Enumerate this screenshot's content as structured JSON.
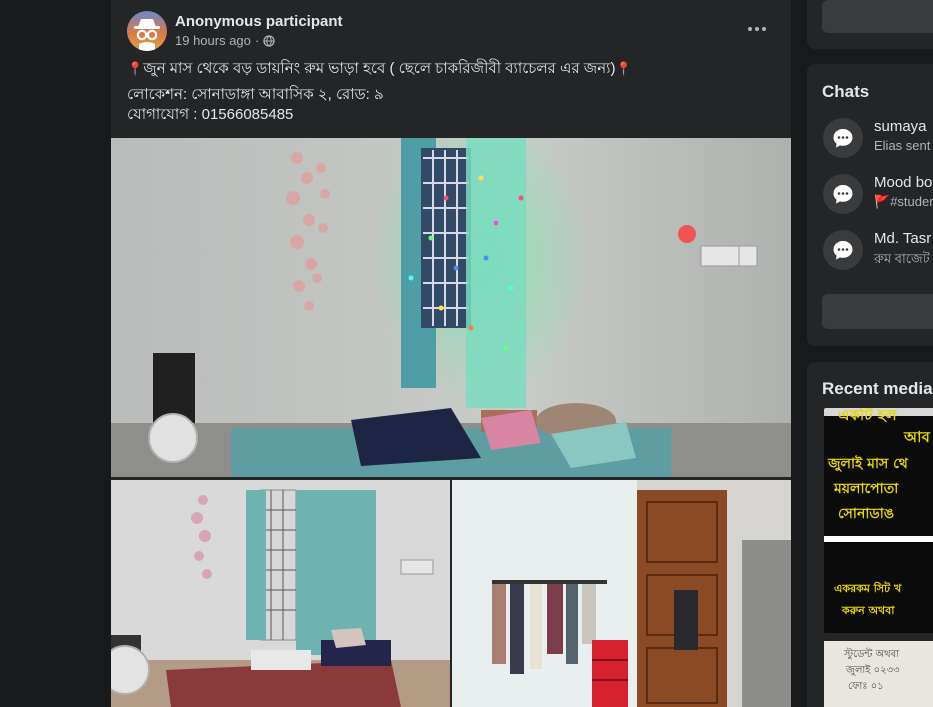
{
  "post": {
    "author": "Anonymous participant",
    "time": "19 hours ago",
    "separator": "·",
    "text_line1": "জুন মাস থেকে বড় ডায়নিং রুম ভাড়া হবে ( ছেলে চাকরিজীবী ব্যাচেলর এর জন্য)",
    "pin_emoji": "📍",
    "text_line2": "লোকেশন: সোনাডাঙ্গা আবাসিক ২, রোড: ৯",
    "text_line3": "যোগাযোগ : 01566085485",
    "icons": {
      "avatar": "anonymous-incognito-icon",
      "privacy": "globe-icon",
      "more": "more-options-icon"
    }
  },
  "sidebar": {
    "chats_title": "Chats",
    "chats": [
      {
        "name": "sumaya",
        "preview": "Elias sent",
        "icon": "chat-bubble-icon"
      },
      {
        "name": "Mood bo",
        "preview": "#studer",
        "flag": "🚩",
        "icon": "chat-bubble-icon"
      },
      {
        "name": "Md. Tasr",
        "preview": "রুম বাজেট",
        "icon": "chat-bubble-icon"
      }
    ],
    "media_title": "Recent media",
    "media_1": {
      "lines": [
        "একটি হল",
        "আব",
        "জুলাই মাস থে",
        "ময়লাপোতা",
        "সোনাডাঙ",
        "একরকম সিট খ",
        "করুন অথবা"
      ]
    },
    "media_2": {
      "lines": [
        "স্টুডেন্ট অথবা",
        "জুলাই ০২৩৩",
        "ফোঃ ০১"
      ]
    }
  },
  "colors": {
    "background": "#18191a",
    "card": "#242526",
    "text_primary": "#e4e6eb",
    "text_secondary": "#b0b3b8",
    "button": "#3a3b3c"
  }
}
